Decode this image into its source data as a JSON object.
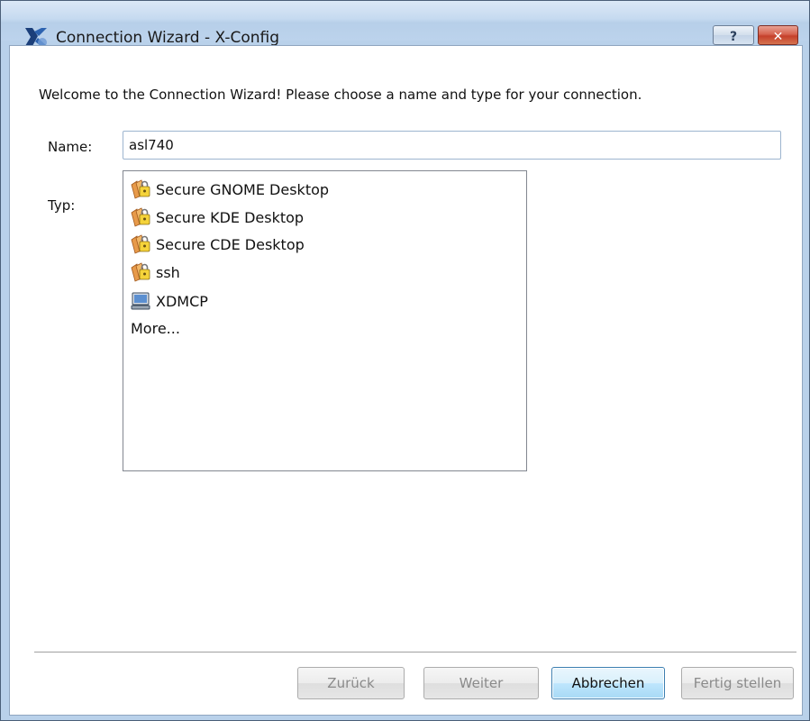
{
  "window": {
    "title": "Connection Wizard - X-Config"
  },
  "titlebar": {
    "help_label": "?",
    "close_label": "✕"
  },
  "wizard": {
    "welcome": "Welcome to the Connection Wizard!  Please choose a name and type for your connection.",
    "name_label": "Name:",
    "name_value": "asl740",
    "type_label": "Typ:",
    "types": [
      {
        "label": "Secure GNOME Desktop",
        "icon": "secure-key-icon"
      },
      {
        "label": "Secure KDE Desktop",
        "icon": "secure-key-icon"
      },
      {
        "label": "Secure CDE Desktop",
        "icon": "secure-key-icon"
      },
      {
        "label": "ssh",
        "icon": "secure-key-icon"
      },
      {
        "label": "XDMCP",
        "icon": "computer-icon"
      },
      {
        "label": "More...",
        "icon": ""
      }
    ]
  },
  "buttons": {
    "back": "Zurück",
    "next": "Weiter",
    "cancel": "Abbrechen",
    "finish": "Fertig stellen"
  },
  "colors": {
    "titlebar": "#c6daf0",
    "close_button": "#c5402b",
    "primary_button_border": "#3c7fb1"
  }
}
